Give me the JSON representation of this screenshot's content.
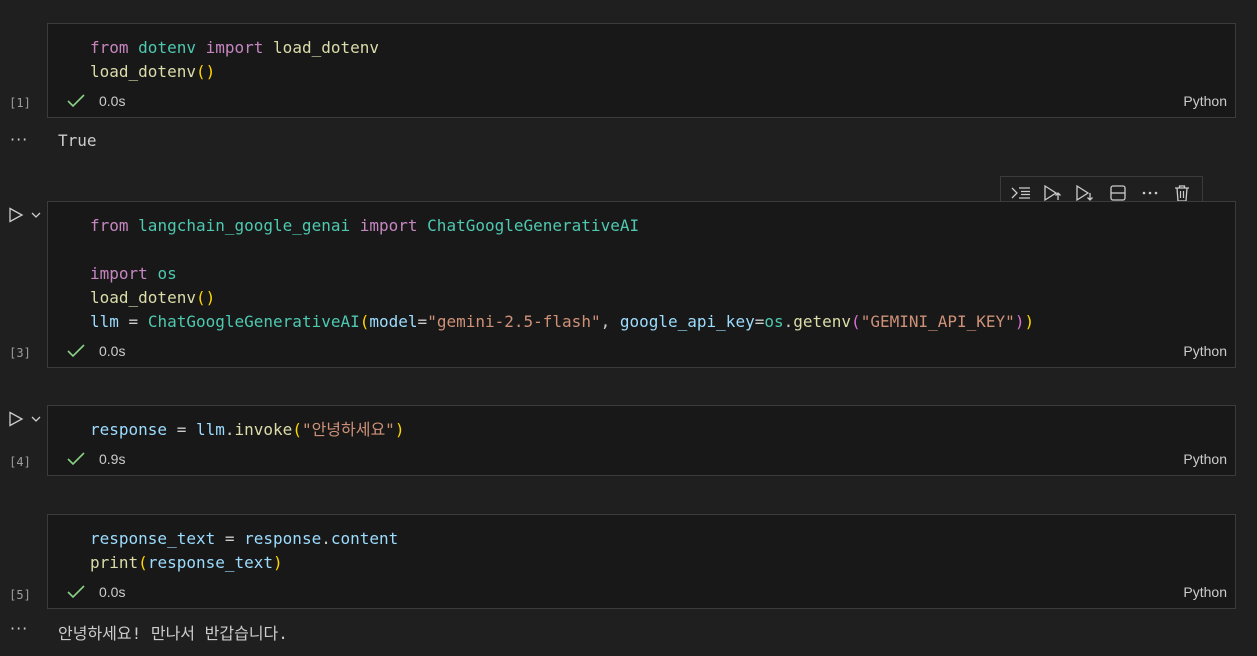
{
  "cells": [
    {
      "exec_count": "[1]",
      "time": "0.0s",
      "language": "Python",
      "output": "True",
      "code_lines": [
        [
          [
            "kw",
            "from"
          ],
          [
            "op",
            " "
          ],
          [
            "mod",
            "dotenv"
          ],
          [
            "op",
            " "
          ],
          [
            "kw",
            "import"
          ],
          [
            "op",
            " "
          ],
          [
            "fn",
            "load_dotenv"
          ]
        ],
        [
          [
            "fn",
            "load_dotenv"
          ],
          [
            "p1",
            "()"
          ]
        ]
      ]
    },
    {
      "exec_count": "[3]",
      "time": "0.0s",
      "language": "Python",
      "code_lines": [
        [
          [
            "kw",
            "from"
          ],
          [
            "op",
            " "
          ],
          [
            "mod",
            "langchain_google_genai"
          ],
          [
            "op",
            " "
          ],
          [
            "kw",
            "import"
          ],
          [
            "op",
            " "
          ],
          [
            "mod",
            "ChatGoogleGenerativeAI"
          ]
        ],
        [],
        [
          [
            "kw",
            "import"
          ],
          [
            "op",
            " "
          ],
          [
            "mod",
            "os"
          ]
        ],
        [
          [
            "fn",
            "load_dotenv"
          ],
          [
            "p1",
            "()"
          ]
        ],
        [
          [
            "var",
            "llm"
          ],
          [
            "op",
            " = "
          ],
          [
            "mod",
            "ChatGoogleGenerativeAI"
          ],
          [
            "p1",
            "("
          ],
          [
            "var",
            "model"
          ],
          [
            "op",
            "="
          ],
          [
            "str",
            "\"gemini-2.5-flash\""
          ],
          [
            "op",
            ", "
          ],
          [
            "var",
            "google_api_key"
          ],
          [
            "op",
            "="
          ],
          [
            "mod",
            "os"
          ],
          [
            "op",
            "."
          ],
          [
            "fn",
            "getenv"
          ],
          [
            "p2",
            "("
          ],
          [
            "str",
            "\"GEMINI_API_KEY\""
          ],
          [
            "p2",
            ")"
          ],
          [
            "p1",
            ")"
          ]
        ]
      ]
    },
    {
      "exec_count": "[4]",
      "time": "0.9s",
      "language": "Python",
      "code_lines": [
        [
          [
            "var",
            "response"
          ],
          [
            "op",
            " = "
          ],
          [
            "var",
            "llm"
          ],
          [
            "op",
            "."
          ],
          [
            "fn",
            "invoke"
          ],
          [
            "p1",
            "("
          ],
          [
            "str",
            "\"안녕하세요\""
          ],
          [
            "p1",
            ")"
          ]
        ]
      ]
    },
    {
      "exec_count": "[5]",
      "time": "0.0s",
      "language": "Python",
      "output": "안녕하세요! 만나서 반갑습니다.",
      "code_lines": [
        [
          [
            "var",
            "response_text"
          ],
          [
            "op",
            " = "
          ],
          [
            "var",
            "response"
          ],
          [
            "op",
            "."
          ],
          [
            "var",
            "content"
          ]
        ],
        [
          [
            "fn",
            "print"
          ],
          [
            "p1",
            "("
          ],
          [
            "var",
            "response_text"
          ],
          [
            "p1",
            ")"
          ]
        ]
      ]
    }
  ],
  "output_more_icon": "ellipsis-icon",
  "toolbar_icons": [
    "execute-above-icon",
    "run-above-icon",
    "run-below-icon",
    "split-cell-icon",
    "more-actions-icon",
    "delete-icon"
  ],
  "colors": {
    "background": "#1f1f1f",
    "cell_background": "#181818",
    "check": "#89d185",
    "keyword": "#c586c0",
    "module": "#4ec9b0",
    "function": "#dcdcaa",
    "variable": "#9cdcfe",
    "string": "#ce9178"
  }
}
